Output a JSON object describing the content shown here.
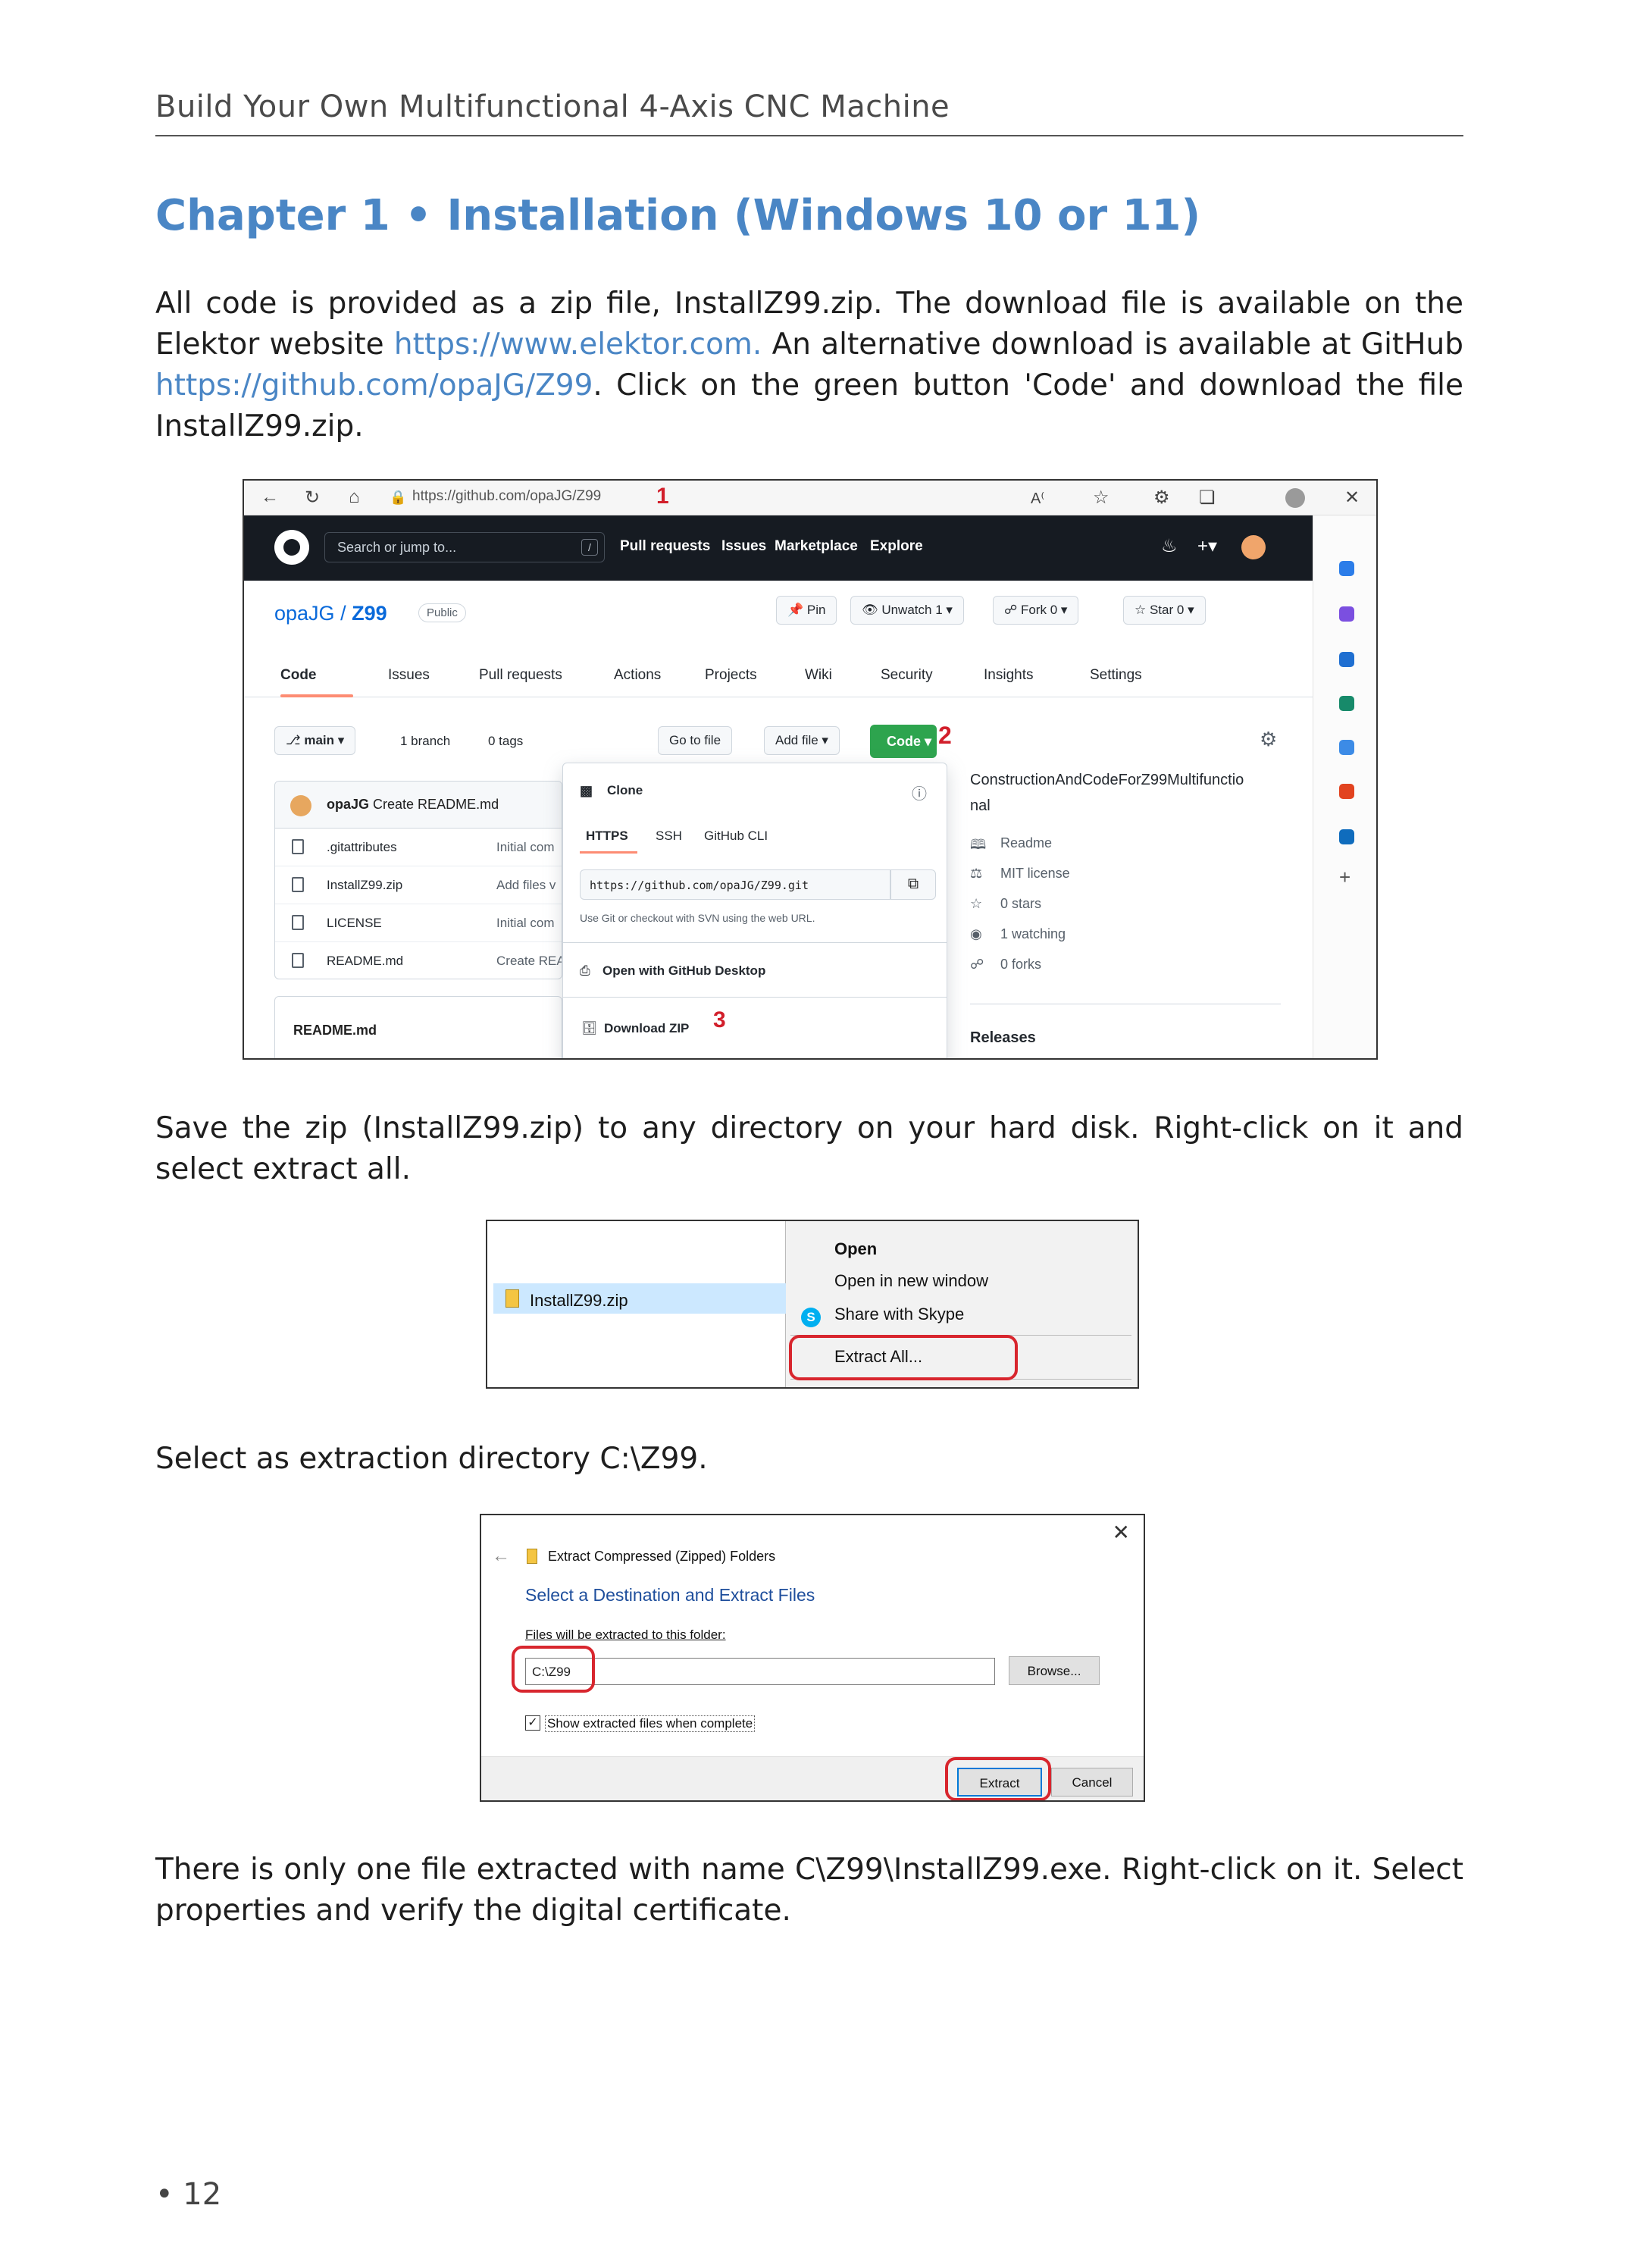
{
  "running_header": "Build Your Own Multifunctional 4-Axis CNC Machine",
  "chapter_title": "Chapter 1 • Installation (Windows 10 or 11)",
  "intro": {
    "t1": "All code is provided as a zip file, InstallZ99.zip. The download file is available on the Elektor website ",
    "link1": "https://www.elektor.com.",
    "t2": " An alternative download is available at GitHub ",
    "link2": "https://github.com/opaJG/Z99",
    "t3": ". Click on the green button 'Code' and download the file InstallZ99.zip."
  },
  "browser": {
    "url": "https://github.com/opaJG/Z99",
    "step1": "1",
    "step2": "2",
    "step3": "3",
    "icons": [
      "back-icon",
      "refresh-icon",
      "home-icon",
      "lock-icon"
    ],
    "toolbar_icons": [
      "read-aloud-icon",
      "favorites-icon",
      "extensions-icon",
      "collections-icon",
      "profile-icon",
      "close-icon"
    ]
  },
  "github": {
    "search_placeholder": "Search or jump to...",
    "slash": "/",
    "nav": [
      "Pull requests",
      "Issues",
      "Marketplace",
      "Explore"
    ],
    "owner": "opaJG",
    "sep": "/",
    "repo": "Z99",
    "visibility": "Public",
    "pin": "Pin",
    "unwatch": "Unwatch",
    "unwatch_count": "1",
    "fork": "Fork",
    "fork_count": "0",
    "star": "Star",
    "star_count": "0",
    "tabs": [
      "Code",
      "Issues",
      "Pull requests",
      "Actions",
      "Projects",
      "Wiki",
      "Security",
      "Insights",
      "Settings"
    ],
    "branch": "main",
    "branches": "1 branch",
    "tags": "0 tags",
    "go_to_file": "Go to file",
    "add_file": "Add file ▾",
    "code_btn": "Code ▾",
    "commit_user": "opaJG",
    "commit_msg": "Create README.md",
    "files": [
      {
        "name": ".gitattributes",
        "msg": "Initial com"
      },
      {
        "name": "InstallZ99.zip",
        "msg": "Add files v"
      },
      {
        "name": "LICENSE",
        "msg": "Initial com"
      },
      {
        "name": "README.md",
        "msg": "Create REA"
      }
    ],
    "readme_header": "README.md",
    "clone": {
      "title": "Clone",
      "tabs": [
        "HTTPS",
        "SSH",
        "GitHub CLI"
      ],
      "url": "https://github.com/opaJG/Z99.git",
      "hint": "Use Git or checkout with SVN using the web URL.",
      "open_desktop": "Open with GitHub Desktop",
      "download_zip": "Download ZIP"
    },
    "about": {
      "title_line1": "ConstructionAndCodeForZ99Multifunctio",
      "title_line2": "nal",
      "readme": "Readme",
      "license": "MIT license",
      "stars": "0 stars",
      "watching": "1 watching",
      "forks": "0 forks",
      "releases": "Releases"
    }
  },
  "save_para": "Save the zip (InstallZ99.zip) to any directory on your hard disk. Right-click on it and select extract all.",
  "explorer": {
    "file": "InstallZ99.zip",
    "menu": [
      "Open",
      "Open in new window",
      "Share with Skype",
      "Extract All..."
    ],
    "skype_letter": "S"
  },
  "select_para": "Select as extraction directory C:\\Z99.",
  "dialog": {
    "caption": "Extract Compressed (Zipped) Folders",
    "heading": "Select a Destination and Extract Files",
    "label": "Files will be extracted to this folder:",
    "path": "C:\\Z99",
    "browse": "Browse...",
    "checkbox": "Show extracted files when complete",
    "extract": "Extract",
    "cancel": "Cancel"
  },
  "final_para": "There is only one file extracted with name C\\Z99\\InstallZ99.exe. Right-click on it. Select properties and verify the digital certificate.",
  "page_number": "• 12",
  "colors": {
    "accent": "#4a86c5",
    "github_dark": "#161b22",
    "github_green": "#2da44e",
    "annotation_red": "#d21f2b"
  }
}
